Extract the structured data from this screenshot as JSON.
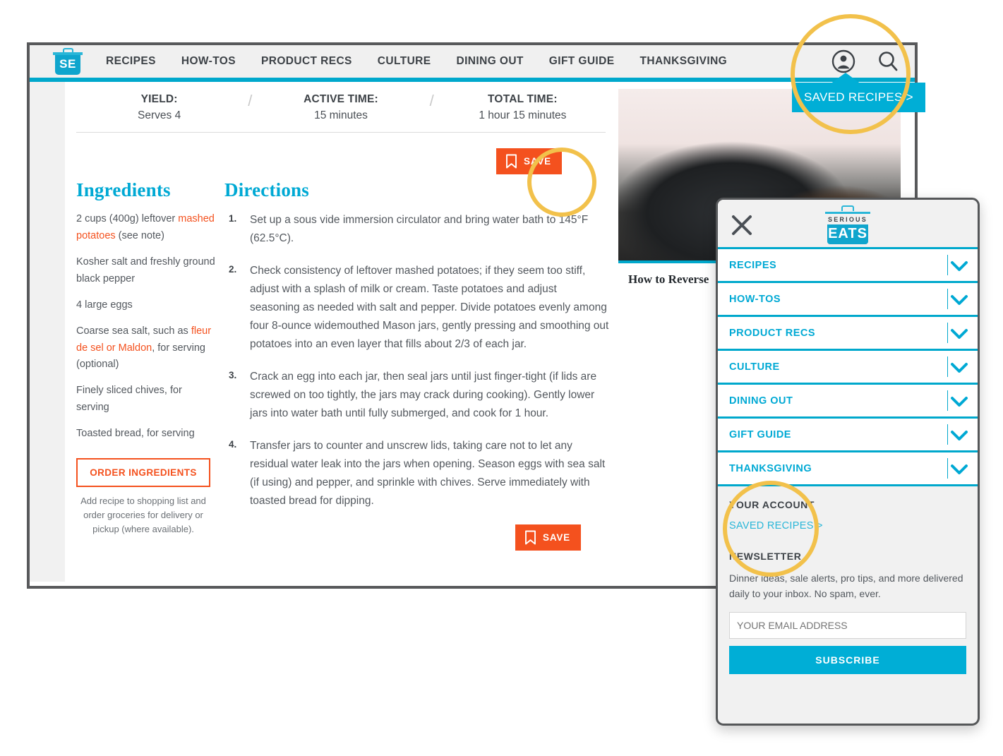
{
  "site": {
    "logo_text": "SE",
    "logo_serious": "SERIOUS",
    "logo_eats": "EATS"
  },
  "navbar": {
    "links": [
      {
        "label": "RECIPES"
      },
      {
        "label": "HOW-TOS"
      },
      {
        "label": "PRODUCT RECS"
      },
      {
        "label": "CULTURE"
      },
      {
        "label": "DINING OUT"
      },
      {
        "label": "GIFT GUIDE"
      },
      {
        "label": "THANKSGIVING"
      }
    ],
    "account_icon": "account-circle-icon",
    "search_icon": "search-icon"
  },
  "saved_tooltip": {
    "label": "SAVED RECIPES >"
  },
  "recipe_meta": [
    {
      "label": "YIELD:",
      "value": "Serves 4"
    },
    {
      "label": "ACTIVE TIME:",
      "value": "15 minutes"
    },
    {
      "label": "TOTAL TIME:",
      "value": "1 hour 15 minutes"
    }
  ],
  "meta_separator": "/",
  "save_button": {
    "label": "SAVE",
    "icon": "bookmark-icon"
  },
  "ingredients": {
    "heading": "Ingredients",
    "items": [
      {
        "pre": "2 cups (400g) leftover ",
        "link": "mashed potatoes",
        "post": " (see note)"
      },
      {
        "pre": "Kosher salt and freshly ground black pepper",
        "link": "",
        "post": ""
      },
      {
        "pre": "4 large eggs",
        "link": "",
        "post": ""
      },
      {
        "pre": "Coarse sea salt, such as ",
        "link": "fleur de sel or Maldon",
        "post": ", for serving (optional)"
      },
      {
        "pre": "Finely sliced chives, for serving",
        "link": "",
        "post": ""
      },
      {
        "pre": "Toasted bread, for serving",
        "link": "",
        "post": ""
      }
    ],
    "order_button": "ORDER INGREDIENTS",
    "order_note": "Add recipe to shopping list and order groceries for delivery or pickup (where available)."
  },
  "directions": {
    "heading": "Directions",
    "steps": [
      "Set up a sous vide immersion circulator and bring water bath to 145°F (62.5°C).",
      "Check consistency of leftover mashed potatoes; if they seem too stiff, adjust with a splash of milk or cream. Taste potatoes and adjust seasoning as needed with salt and pepper. Divide potatoes evenly among four 8-ounce widemouthed Mason jars, gently pressing and smoothing out potatoes into an even layer that fills about 2/3 of each jar.",
      "Crack an egg into each jar, then seal jars until just finger-tight (if lids are screwed on too tightly, the jars may crack during cooking). Gently lower jars into water bath until fully submerged, and cook for 1 hour.",
      "Transfer jars to counter and unscrew lids, taking care not to let any residual water leak into the jars when opening. Season eggs with sea salt (if using) and pepper, and sprinkle with chives. Serve immediately with toasted bread for dipping."
    ]
  },
  "right_rail": {
    "card_title": "How to Reverse",
    "card_image_alt": "cast-iron-skillet-steak-photo"
  },
  "mobile_menu": {
    "close_icon": "close-icon",
    "items": [
      {
        "label": "RECIPES",
        "chevron": "chevron-down-icon"
      },
      {
        "label": "HOW-TOS",
        "chevron": "chevron-down-icon"
      },
      {
        "label": "PRODUCT RECS",
        "chevron": "chevron-down-icon"
      },
      {
        "label": "CULTURE",
        "chevron": "chevron-down-icon"
      },
      {
        "label": "DINING OUT",
        "chevron": "chevron-down-icon"
      },
      {
        "label": "GIFT GUIDE",
        "chevron": "chevron-down-icon"
      },
      {
        "label": "THANKSGIVING",
        "chevron": "chevron-down-icon"
      }
    ],
    "account_section_title": "YOUR ACCOUNT",
    "saved_recipes_link": "SAVED RECIPES >",
    "newsletter_title": "NEWSLETTER",
    "newsletter_text": "Dinner ideas, sale alerts, pro tips, and more delivered daily to your inbox. No spam, ever.",
    "email_placeholder": "YOUR EMAIL ADDRESS",
    "email_value": "",
    "subscribe_label": "SUBSCRIBE"
  },
  "colors": {
    "brand_teal": "#00a8cc",
    "accent_orange": "#f4511e",
    "highlight_yellow": "#f2c14b",
    "text_dark": "#3d4247",
    "frame_gray": "#58595b"
  }
}
